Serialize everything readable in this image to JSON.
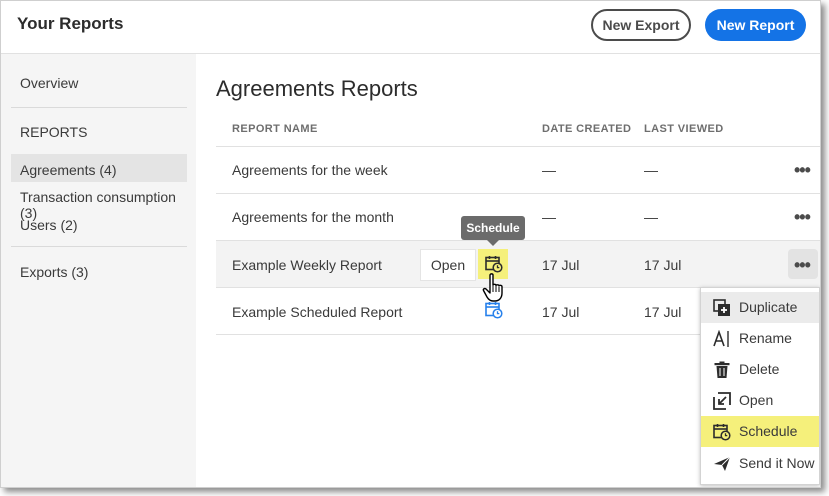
{
  "header": {
    "title": "Your Reports",
    "new_export": "New Export",
    "new_report": "New Report"
  },
  "sidebar": {
    "overview": "Overview",
    "section": "REPORTS",
    "items": [
      {
        "label": "Agreements (4)"
      },
      {
        "label": "Transaction consumption (3)"
      },
      {
        "label": "Users (2)"
      }
    ],
    "exports": "Exports (3)"
  },
  "main": {
    "title": "Agreements Reports",
    "columns": {
      "name": "REPORT NAME",
      "created": "DATE CREATED",
      "viewed": "LAST VIEWED"
    },
    "rows": [
      {
        "name": "Agreements for the week",
        "created": "—",
        "viewed": "—"
      },
      {
        "name": "Agreements for the month",
        "created": "—",
        "viewed": "—"
      },
      {
        "name": "Example Weekly Report",
        "created": "17 Jul",
        "viewed": "17 Jul"
      },
      {
        "name": "Example Scheduled Report",
        "created": "17 Jul",
        "viewed": "17 Jul"
      }
    ],
    "more": "•••",
    "open_button": "Open",
    "tooltip": "Schedule"
  },
  "menu": {
    "items": [
      {
        "label": "Duplicate",
        "icon": "duplicate-icon"
      },
      {
        "label": "Rename",
        "icon": "rename-icon"
      },
      {
        "label": "Delete",
        "icon": "trash-icon"
      },
      {
        "label": "Open",
        "icon": "open-icon"
      },
      {
        "label": "Schedule",
        "icon": "calendar-clock-icon"
      },
      {
        "label": "Send it Now",
        "icon": "send-icon"
      }
    ]
  },
  "colors": {
    "primary": "#1473e6",
    "highlight": "#f5f07b",
    "icon_blue": "#2680eb"
  }
}
